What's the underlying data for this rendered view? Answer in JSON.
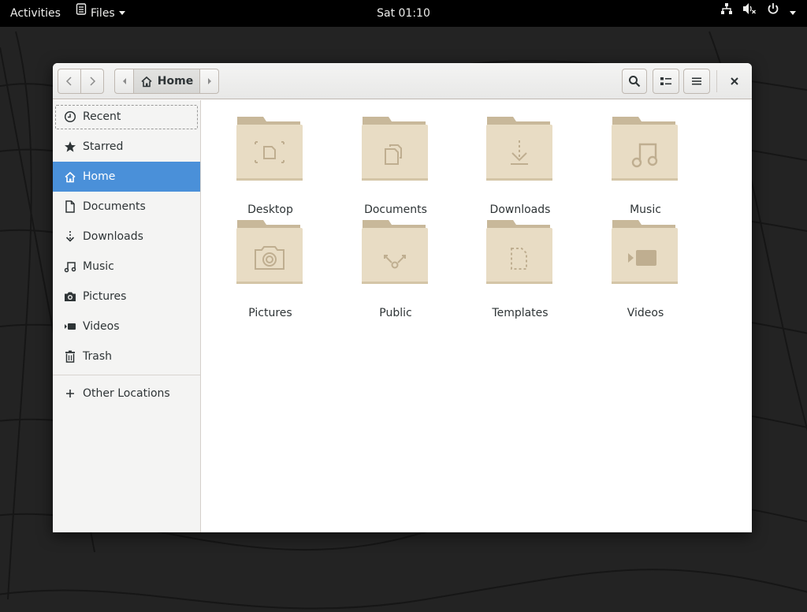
{
  "topbar": {
    "activities": "Activities",
    "app_name": "Files",
    "clock": "Sat 01:10",
    "icons": [
      "network-icon",
      "volume-muted-icon",
      "power-icon"
    ]
  },
  "window": {
    "path": {
      "current": "Home"
    }
  },
  "sidebar": {
    "items": [
      {
        "label": "Recent",
        "icon": "clock-icon",
        "state": "focused"
      },
      {
        "label": "Starred",
        "icon": "star-icon"
      },
      {
        "label": "Home",
        "icon": "home-icon",
        "state": "selected"
      },
      {
        "label": "Documents",
        "icon": "document-icon"
      },
      {
        "label": "Downloads",
        "icon": "download-icon"
      },
      {
        "label": "Music",
        "icon": "music-icon"
      },
      {
        "label": "Pictures",
        "icon": "camera-icon"
      },
      {
        "label": "Videos",
        "icon": "video-icon"
      },
      {
        "label": "Trash",
        "icon": "trash-icon"
      }
    ],
    "other_locations": "Other Locations"
  },
  "folders": [
    {
      "name": "Desktop",
      "emblem": "desktop-emblem"
    },
    {
      "name": "Documents",
      "emblem": "documents-emblem"
    },
    {
      "name": "Downloads",
      "emblem": "downloads-emblem"
    },
    {
      "name": "Music",
      "emblem": "music-emblem"
    },
    {
      "name": "Pictures",
      "emblem": "pictures-emblem"
    },
    {
      "name": "Public",
      "emblem": "public-emblem"
    },
    {
      "name": "Templates",
      "emblem": "templates-emblem"
    },
    {
      "name": "Videos",
      "emblem": "videos-emblem"
    }
  ],
  "colors": {
    "selection": "#4a90d9",
    "folder_tab": "#c8b89a",
    "folder_body": "#e8dcc4",
    "folder_emblem": "#bfae90"
  }
}
